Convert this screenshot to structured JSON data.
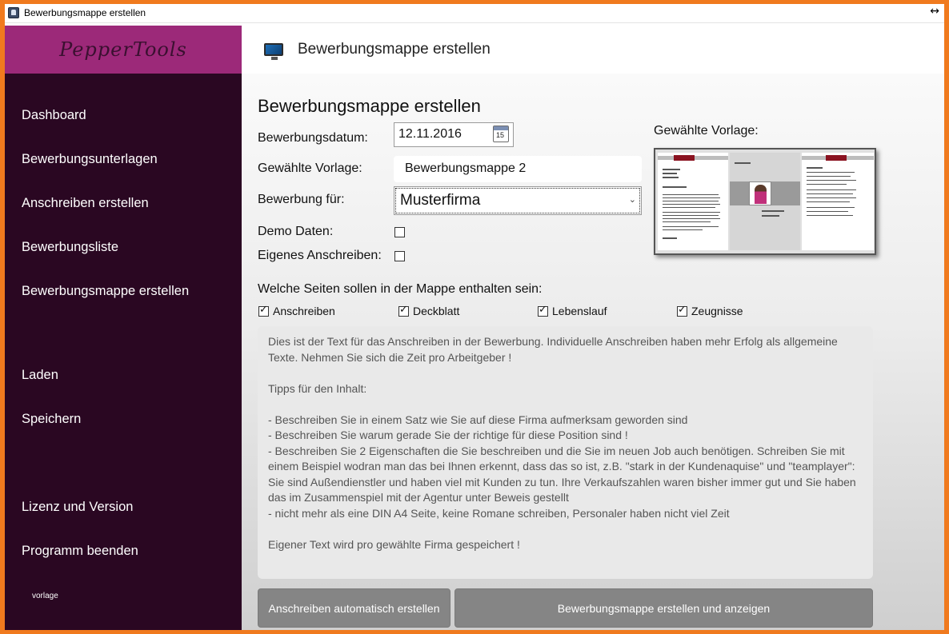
{
  "window": {
    "title": "Bewerbungsmappe erstellen",
    "resize_glyph": "↔"
  },
  "sidebar": {
    "brand": "PepperTools",
    "items": [
      {
        "label": "Dashboard"
      },
      {
        "label": "Bewerbungsunterlagen"
      },
      {
        "label": "Anschreiben erstellen"
      },
      {
        "label": "Bewerbungsliste"
      },
      {
        "label": "Bewerbungsmappe erstellen"
      },
      {
        "label": "Laden"
      },
      {
        "label": "Speichern"
      },
      {
        "label": "Lizenz und Version"
      },
      {
        "label": "Programm beenden"
      }
    ],
    "footer": "vorlage"
  },
  "header": {
    "title": "Bewerbungsmappe erstellen",
    "icon": "monitor-icon"
  },
  "form": {
    "title": "Bewerbungsmappe erstellen",
    "date_label": "Bewerbungsdatum:",
    "date_value": "12.11.2016",
    "calendar_day": "15",
    "template_label": "Gewählte Vorlage:",
    "template_value": "Bewerbungsmappe 2",
    "company_label": "Bewerbung für:",
    "company_value": "Musterfirma",
    "demo_label": "Demo Daten:",
    "demo_checked": false,
    "own_letter_label": "Eigenes Anschreiben:",
    "own_letter_checked": false,
    "preview_label": "Gewählte Vorlage:"
  },
  "pages": {
    "title": "Welche Seiten sollen in der Mappe enthalten sein:",
    "options": [
      {
        "label": "Anschreiben",
        "checked": true
      },
      {
        "label": "Deckblatt",
        "checked": true
      },
      {
        "label": "Lebenslauf",
        "checked": true
      },
      {
        "label": "Zeugnisse",
        "checked": true
      }
    ]
  },
  "letter_text": "Dies ist der Text für das Anschreiben in der Bewerbung. Individuelle Anschreiben haben mehr Erfolg als allgemeine Texte. Nehmen Sie sich die Zeit pro Arbeitgeber !\n\nTipps für den Inhalt:\n\n- Beschreiben Sie in einem Satz wie Sie auf diese Firma aufmerksam geworden sind\n- Beschreiben Sie warum gerade Sie der richtige für diese Position sind !\n- Beschreiben Sie 2 Eigenschaften die Sie beschreiben und die Sie im neuen Job auch benötigen. Schreiben Sie mit einem Beispiel wodran man das bei Ihnen erkennt, dass das so ist, z.B. \"stark in der Kundenaquise\" und \"teamplayer\": Sie sind Außendienstler und haben viel mit Kunden zu tun. Ihre Verkaufszahlen waren bisher immer gut und Sie haben das im Zusammenspiel mit der Agentur unter Beweis gestellt\n- nicht mehr als eine DIN A4 Seite, keine Romane schreiben, Personaler haben nicht viel Zeit\n\nEigener Text wird pro gewählte Firma gespeichert !",
  "buttons": {
    "auto_letter": "Anschreiben automatisch erstellen",
    "create_folder": "Bewerbungsmappe erstellen und anzeigen"
  },
  "colors": {
    "frame": "#f07a1e",
    "sidebar_bg": "#2a0722",
    "brand_bg": "#9c2979",
    "button_bg": "#858585"
  }
}
